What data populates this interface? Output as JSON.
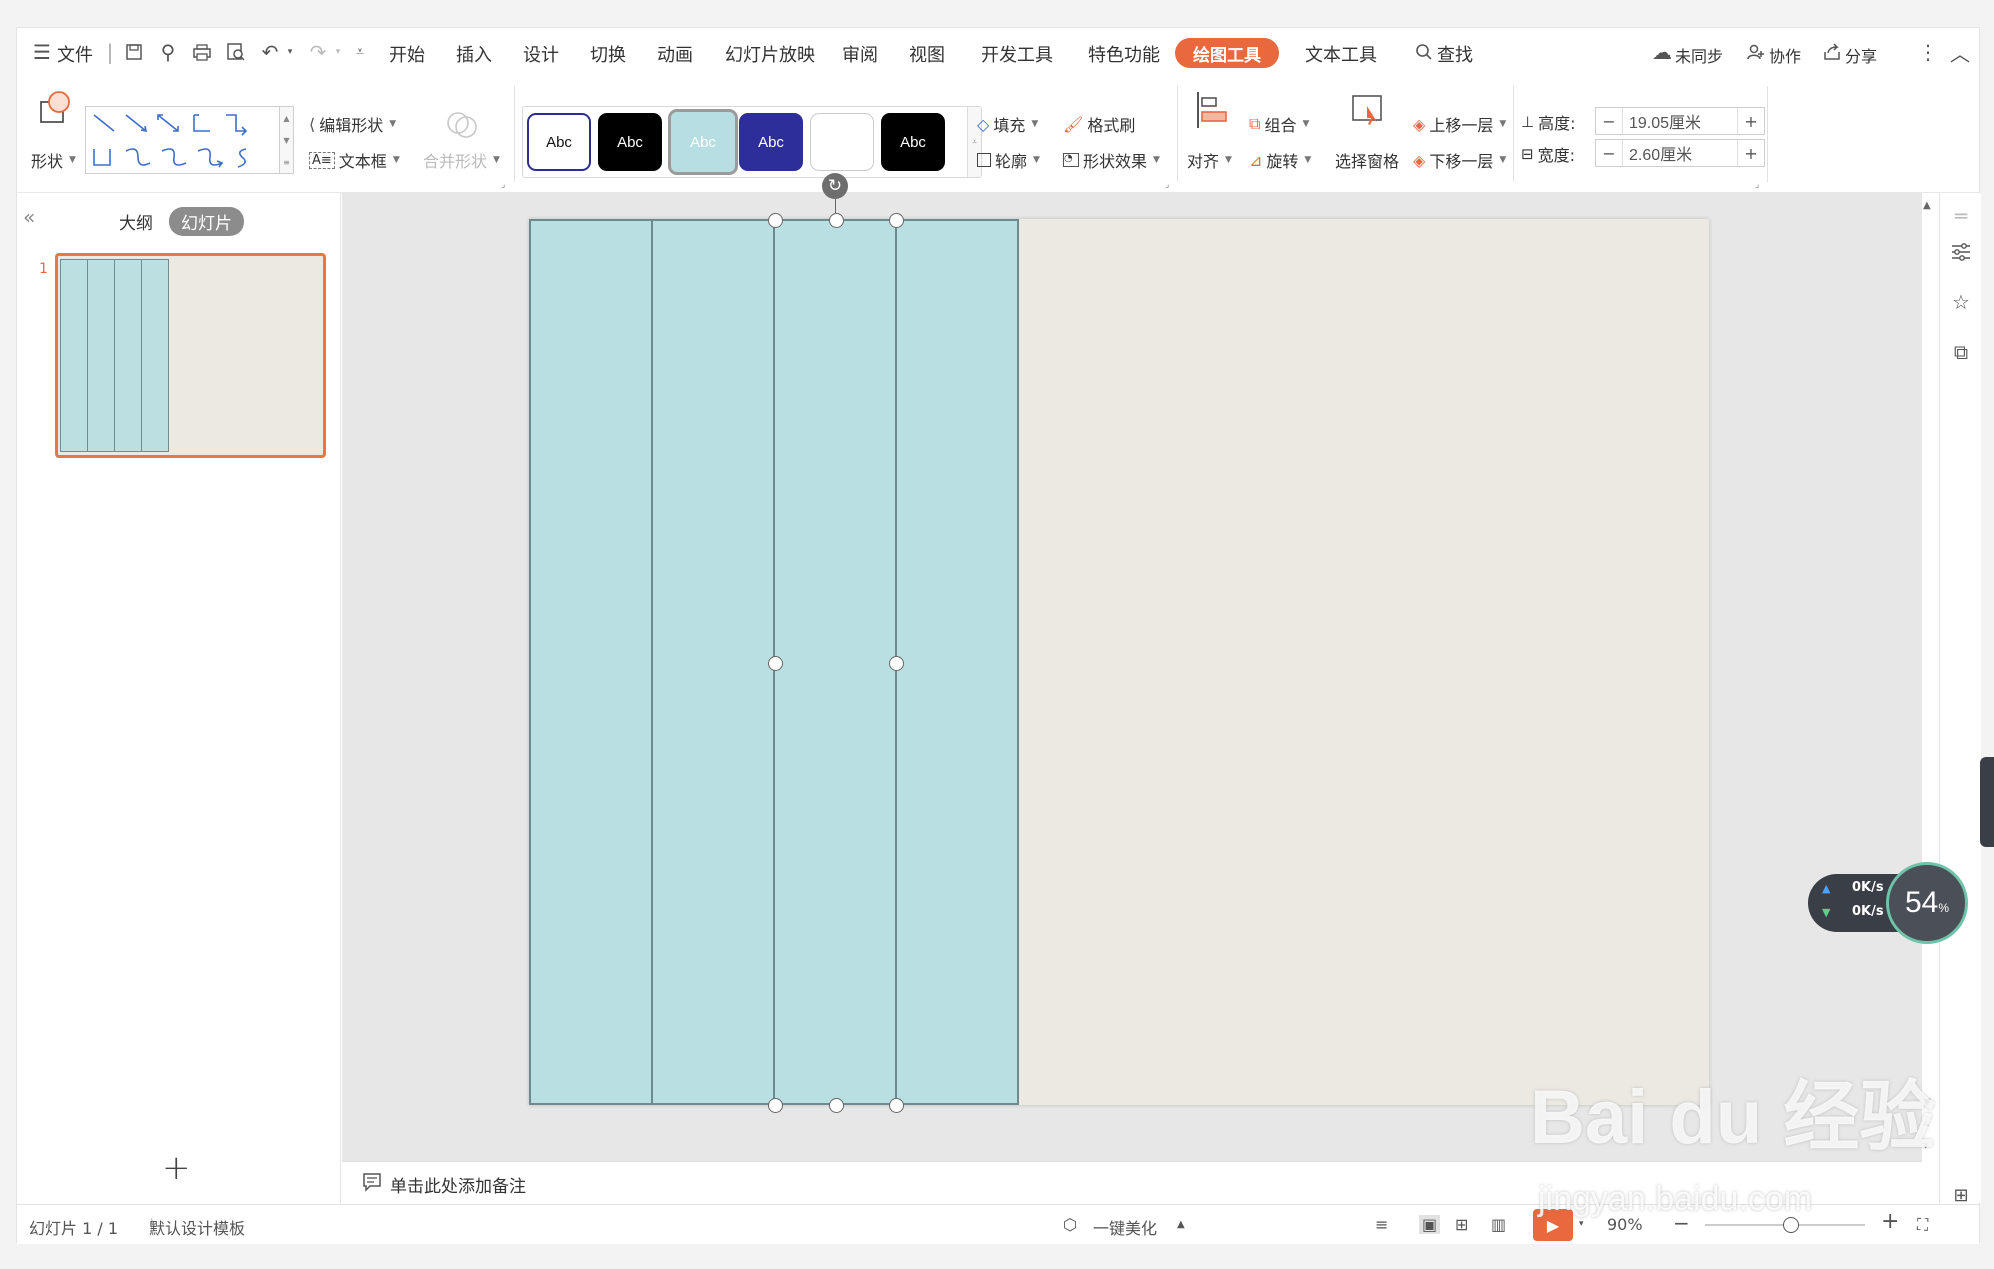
{
  "menubar": {
    "file": "文件",
    "tabs": [
      "开始",
      "插入",
      "设计",
      "切换",
      "动画",
      "幻灯片放映",
      "审阅",
      "视图",
      "开发工具",
      "特色功能"
    ],
    "active_tab": "绘图工具",
    "text_tools": "文本工具",
    "search": "查找",
    "sync": "未同步",
    "collab": "协作",
    "share": "分享"
  },
  "ribbon": {
    "shape": "形状",
    "edit_shape": "编辑形状",
    "text_box": "文本框",
    "merge_shape": "合并形状",
    "style_label": "Abc",
    "fill": "填充",
    "format_painter": "格式刷",
    "outline": "轮廓",
    "shape_effects": "形状效果",
    "align": "对齐",
    "group": "组合",
    "rotate": "旋转",
    "selection_pane": "选择窗格",
    "bring_forward": "上移一层",
    "send_backward": "下移一层",
    "height_label": "高度:",
    "height_value": "19.05厘米",
    "width_label": "宽度:",
    "width_value": "2.60厘米"
  },
  "left_panel": {
    "outline_tab": "大纲",
    "slides_tab": "幻灯片",
    "slide_number": "1"
  },
  "notes": {
    "placeholder": "单击此处添加备注"
  },
  "statusbar": {
    "slide_info": "幻灯片 1 / 1",
    "template": "默认设计模板",
    "beautify": "一键美化",
    "zoom": "90%"
  },
  "speed_widget": {
    "up": "0K/s",
    "down": "0K/s",
    "percent": "54",
    "unit": "%"
  },
  "watermark": {
    "brand": "Bai du 经验",
    "url": "jingyan.baidu.com"
  },
  "colors": {
    "accent": "#e9683e",
    "column_fill": "#badfe2",
    "slide_bg": "#ebe9e2"
  }
}
